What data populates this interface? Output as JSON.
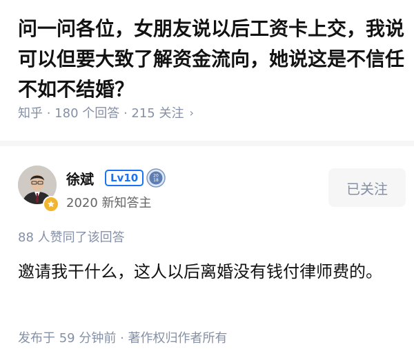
{
  "question": {
    "title": "问一问各位，女朋友说以后工资卡上交，我说可以但要大致了解资金流向，她说这是不信任不如不结婚？",
    "meta": "知乎 · 180 个回答 · 215 关注"
  },
  "author": {
    "name": "徐斌",
    "level_badge": "Lv10",
    "round_badge_text": "20 18",
    "description": "2020 新知答主",
    "follow_label": "已关注"
  },
  "answer": {
    "votes": "88 人赞同了该回答",
    "content": "邀请我干什么，这人以后离婚没有钱付律师费的。",
    "footer": "发布于 59 分钟前 · 著作权归作者所有"
  },
  "colors": {
    "accent": "#1772f6",
    "meta_text": "#8590a6",
    "badge_gold": "#f2b530"
  }
}
